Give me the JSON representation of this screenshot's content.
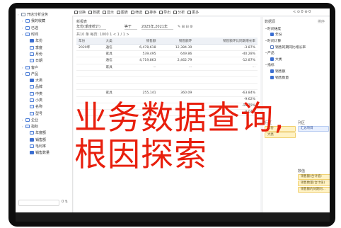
{
  "overlay": {
    "line1": "业务数据查询,",
    "line2": "根因探索"
  },
  "tree": {
    "items": [
      {
        "label": "开店分析业务",
        "indent": 0,
        "kind": "folder"
      },
      {
        "label": "我的收藏",
        "indent": 1,
        "kind": "field"
      },
      {
        "label": "已选",
        "indent": 1,
        "kind": "field"
      },
      {
        "label": "时间",
        "indent": 1,
        "kind": "field"
      },
      {
        "label": "年份",
        "indent": 2,
        "kind": "check"
      },
      {
        "label": "季度",
        "indent": 2,
        "kind": "field"
      },
      {
        "label": "月份",
        "indent": 2,
        "kind": "field"
      },
      {
        "label": "日期",
        "indent": 2,
        "kind": "field"
      },
      {
        "label": "客户",
        "indent": 1,
        "kind": "field"
      },
      {
        "label": "产品",
        "indent": 1,
        "kind": "field"
      },
      {
        "label": "大类",
        "indent": 2,
        "kind": "check"
      },
      {
        "label": "品牌",
        "indent": 2,
        "kind": "field"
      },
      {
        "label": "中类",
        "indent": 2,
        "kind": "field"
      },
      {
        "label": "小类",
        "indent": 2,
        "kind": "field"
      },
      {
        "label": "名称",
        "indent": 2,
        "kind": "field"
      },
      {
        "label": "型号",
        "indent": 2,
        "kind": "field"
      },
      {
        "label": "企业",
        "indent": 1,
        "kind": "field"
      },
      {
        "label": "指标",
        "indent": 1,
        "kind": "field"
      },
      {
        "label": "年度额",
        "indent": 2,
        "kind": "field"
      },
      {
        "label": "销售额",
        "indent": 2,
        "kind": "check"
      },
      {
        "label": "毛利率",
        "indent": 2,
        "kind": "field"
      },
      {
        "label": "销售数量",
        "indent": 2,
        "kind": "check"
      }
    ],
    "footer": "0  ⇅"
  },
  "toolbar": {
    "buttons": [
      "切换",
      "数据",
      "显示",
      "图表",
      "筛选",
      "排序",
      "导出",
      "分析",
      "更多"
    ],
    "right": "< ⊙ 0  ⊖ 0"
  },
  "report": {
    "title": "新报表",
    "filter_field": "年份(季度统计)",
    "filter_op": "等于",
    "filter_value": "2025年,2021年",
    "pager": "共10 条  每页: 1000  1  < 1 / 1 >",
    "columns": [
      "年份",
      "大类",
      "销售额",
      "销售额环",
      "销售额环比同期增长率"
    ],
    "rows": [
      {
        "year": "2020年",
        "cat": "通信",
        "v1": "6,478,618",
        "v2": "12,384.39",
        "v3": "-3.87%",
        "bar": 0.15
      },
      {
        "year": "",
        "cat": "家具",
        "v1": "539,495",
        "v2": "649.86",
        "v3": "-40.28%",
        "bar": 0.6
      },
      {
        "year": "",
        "cat": "通信",
        "v1": "4,719,863",
        "v2": "2,462.79",
        "v3": "-12.87%",
        "bar": 0.3
      },
      {
        "year": "",
        "cat": "家具",
        "v1": "...",
        "v2": "...",
        "v3": "...",
        "bar": 0.0
      },
      {
        "year": "",
        "cat": "",
        "v1": "",
        "v2": "",
        "v3": "",
        "bar": 0.0
      },
      {
        "year": "",
        "cat": "",
        "v1": "",
        "v2": "",
        "v3": "",
        "bar": 0.0
      },
      {
        "year": "",
        "cat": "",
        "v1": "",
        "v2": "",
        "v3": "",
        "bar": 0.0
      },
      {
        "year": "",
        "cat": "家具",
        "v1": "255,141",
        "v2": "360.09",
        "v3": "-63.84%",
        "bar": 0.0
      },
      {
        "year": "",
        "cat": "",
        "v1": "",
        "v2": "",
        "v3": "-9.62%",
        "bar": 0.0
      },
      {
        "year": "",
        "cat": "",
        "v1": "",
        "v2": "",
        "v3": "-10.79%",
        "bar": 0.0
      },
      {
        "year": "",
        "cat": "",
        "v1": "",
        "v2": "",
        "v3": "-8.04%",
        "bar": 0.0
      }
    ]
  },
  "side": {
    "title": "数据源",
    "header_right": "排序",
    "items": [
      {
        "label": "时间维度",
        "kind": "group"
      },
      {
        "label": "年份",
        "kind": "check"
      },
      {
        "label": "时间计算",
        "kind": "group"
      },
      {
        "label": "销售的期同比增长率",
        "kind": "field"
      },
      {
        "label": "产品",
        "kind": "group"
      },
      {
        "label": "大类",
        "kind": "check"
      },
      {
        "label": "指标",
        "kind": "group"
      },
      {
        "label": "销售额",
        "kind": "check"
      },
      {
        "label": "销售数量",
        "kind": "check"
      }
    ],
    "rows_label": "行区",
    "cols_label": "列区",
    "rows_pills": [
      "年份",
      "大类"
    ],
    "cols_pills": [
      "汇总项目"
    ],
    "values_label": "数值",
    "value_pills": [
      "销售额(合计值)",
      "销售数量(合计值)",
      "销售额的同期同..."
    ]
  }
}
